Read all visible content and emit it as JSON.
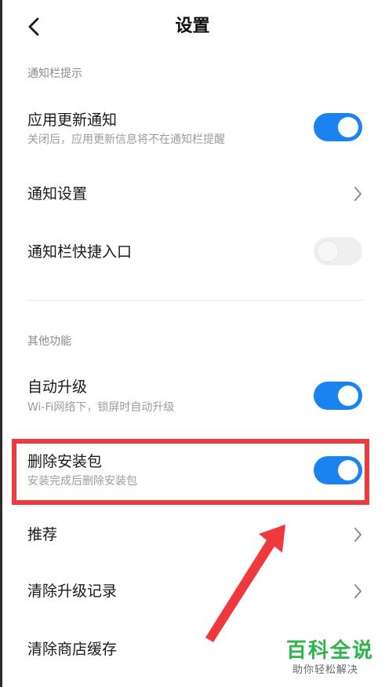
{
  "header": {
    "title": "设置",
    "back_icon": "chevron-left-icon"
  },
  "sections": [
    {
      "title": "通知栏提示",
      "rows": [
        {
          "label": "应用更新通知",
          "sublabel": "关闭后，应用更新信息将不在通知栏提醒",
          "control": "toggle",
          "on": true
        },
        {
          "label": "通知设置",
          "control": "chevron"
        },
        {
          "label": "通知栏快捷入口",
          "control": "toggle",
          "on": false
        }
      ]
    },
    {
      "title": "其他功能",
      "rows": [
        {
          "label": "自动升级",
          "sublabel": "Wi-Fi网络下，锁屏时自动升级",
          "control": "toggle",
          "on": true
        },
        {
          "label": "删除安装包",
          "sublabel": "安装完成后删除安装包",
          "control": "toggle",
          "on": true,
          "highlighted": true
        },
        {
          "label": "推荐",
          "control": "chevron"
        },
        {
          "label": "清除升级记录",
          "control": "chevron"
        },
        {
          "label": "清除商店缓存",
          "control": "none"
        }
      ]
    }
  ],
  "watermark": {
    "main": "百科全说",
    "sub": "助你轻松解决"
  },
  "colors": {
    "toggle_on": "#1a83ef",
    "toggle_off": "#efefef",
    "highlight_border": "#f0393e",
    "watermark_green": "#2db44a"
  }
}
